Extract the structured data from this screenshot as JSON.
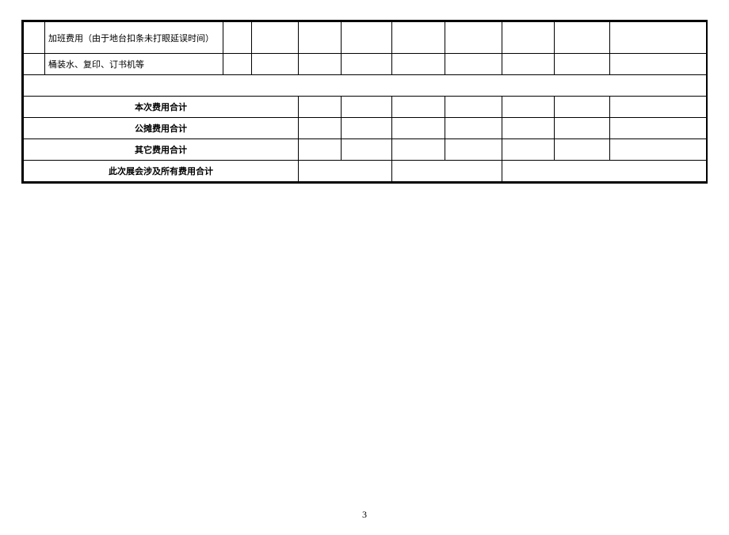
{
  "rows": {
    "item1": "加班费用（由于地台扣条未打眼延误时间）",
    "item2": "桶装水、复印、订书机等",
    "subtotal1": "本次费用合计",
    "subtotal2": "公摊费用合计",
    "subtotal3": "其它费用合计",
    "grandtotal": "此次展会涉及所有费用合计"
  },
  "page_number": "3"
}
